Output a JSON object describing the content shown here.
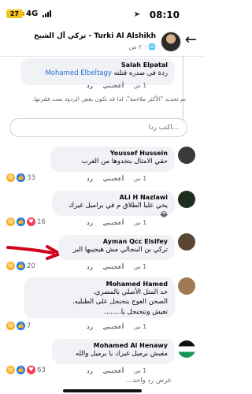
{
  "status_bar": {
    "battery": "27",
    "network": "4G",
    "time": "08:10"
  },
  "header": {
    "title": "تركي آل الشيخ - Turki Al Alshikh",
    "subtitle": "٢ س · 🌐"
  },
  "comments": [
    {
      "name": "Salah Elpatal",
      "mention": "Mohamed Elbeltagy",
      "text": "ردة فى صدره قتلته",
      "time": "1 س",
      "like": "أعجبني",
      "reply": "رد"
    },
    {
      "name": "Youssef Hussein",
      "text": "حقي الامثال بتخدوها من الغرب",
      "time": "1 س",
      "like": "أعجبني",
      "reply": "رد",
      "reactions": "33"
    },
    {
      "name": "ALi H Nazlawi",
      "text": "يخي عليا الطلاق م في براميل غيرك 😂",
      "time": "1 س",
      "like": "أعجبني",
      "reply": "رد",
      "reactions": "16"
    },
    {
      "name": "Ayman Qcc Elsifey",
      "text": "تركي بن البنجالي مش هيجيبها البر",
      "time": "1 س",
      "like": "أعجبني",
      "reply": "رد",
      "reactions": "20"
    },
    {
      "name": "Mohamed Hamed",
      "lines": [
        "خد المثل الأصلي بالمصري.",
        "الصحن العوج يتحنجل على الطبليه.",
        "تعيش وتتحنجل يا........"
      ],
      "time": "1 س",
      "like": "أعجبني",
      "reply": "رد",
      "reactions": "7"
    },
    {
      "name": "Mohamed Al Henawy",
      "lines": [
        "مفيش برميل غيرك يا برميل والله"
      ],
      "time": "1 س",
      "like": "أعجبني",
      "reply": "رد",
      "reactions": "63"
    }
  ],
  "info_note": "تم تحديد \"الأكثر ملاءمة\"، لذا قد تكون بعض الردود تمت فلترتها.",
  "write_placeholder": "اكتب ردا...",
  "more_replies": "عرض رد واحد...",
  "icons": {
    "like": "like-icon",
    "haha": "haha-icon",
    "love": "love-icon"
  },
  "colors": {
    "bubble": "#f0f2f5",
    "mention": "#216fdb",
    "arrow": "#d0021b"
  }
}
